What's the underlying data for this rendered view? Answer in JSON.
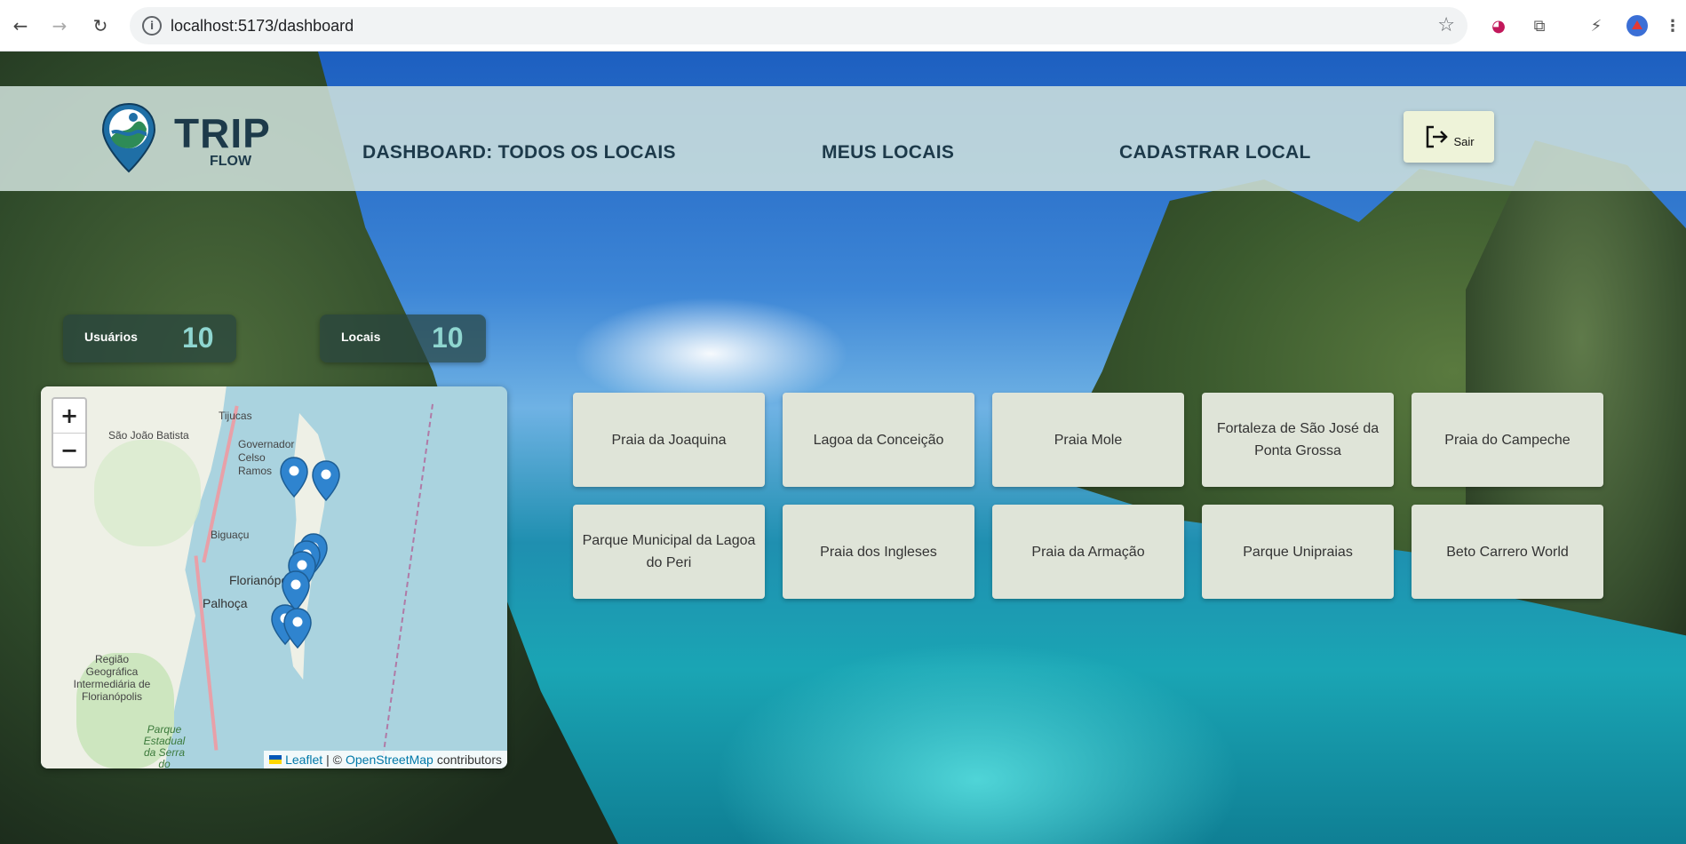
{
  "browser": {
    "url": "localhost:5173/dashboard"
  },
  "header": {
    "logo_trip": "TRIP",
    "logo_flow": "FLOW",
    "nav": [
      {
        "label": "DASHBOARD: TODOS OS LOCAIS"
      },
      {
        "label": "MEUS LOCAIS"
      },
      {
        "label": "CADASTRAR LOCAL"
      }
    ],
    "logout_label": "Sair"
  },
  "stats": [
    {
      "label": "Usuários",
      "value": "10"
    },
    {
      "label": "Locais",
      "value": "10"
    }
  ],
  "map": {
    "zoom_in": "+",
    "zoom_out": "−",
    "towns": [
      "Tijucas",
      "São João Batista",
      "Governador Celso Ramos",
      "Biguaçu",
      "Florianópolis",
      "Palhoça",
      "Região Geográfica Intermediária de Florianópolis",
      "Parque Estadual da Serra do Tabuleiro"
    ],
    "attribution": {
      "leaflet": "Leaflet",
      "separator": "| ©",
      "osm": "OpenStreetMap",
      "contributors": "contributors"
    }
  },
  "places": [
    "Praia da Joaquina",
    "Lagoa da Conceição",
    "Praia Mole",
    "Fortaleza de São José da Ponta Grossa",
    "Praia do Campeche",
    "Parque Municipal da Lagoa do Peri",
    "Praia dos Ingleses",
    "Praia da Armação",
    "Parque Unipraias",
    "Beto Carrero World"
  ],
  "colors": {
    "header_bg": "#d2e4de",
    "nav_text": "#1d3a4a",
    "stat_value": "#8fd6d0",
    "card_bg": "#dfe4d8",
    "logout_bg": "#eef3d9"
  }
}
